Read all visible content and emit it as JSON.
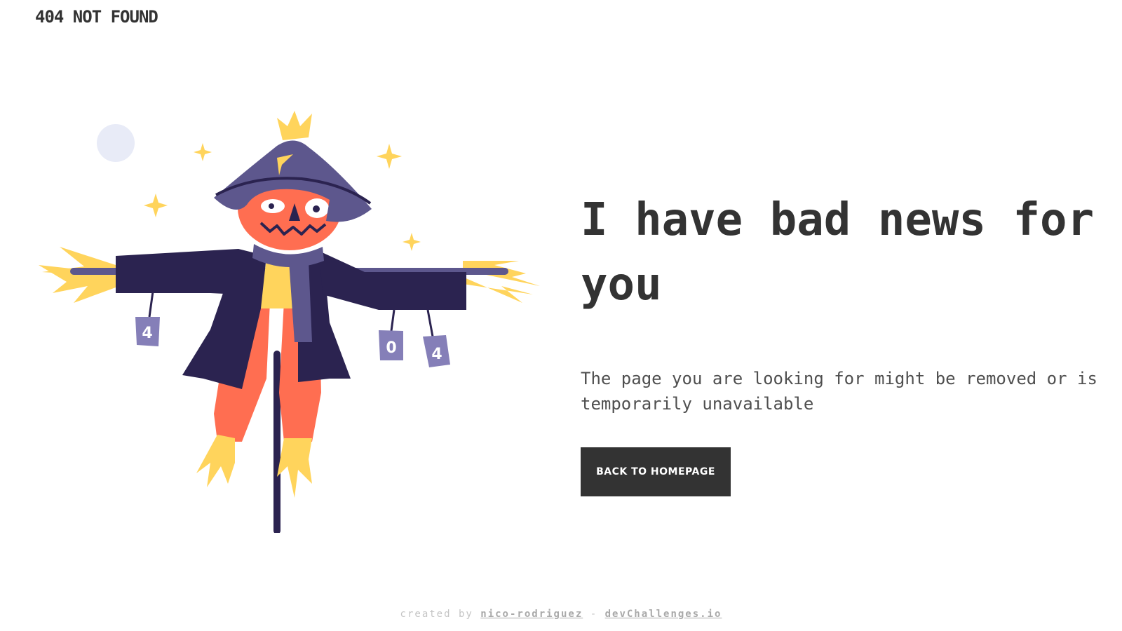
{
  "header": {
    "brand": "404 NOT FOUND"
  },
  "illustration": {
    "icon": "scarecrow-illustration",
    "can_labels": [
      "4",
      "0",
      "4"
    ]
  },
  "main": {
    "headline": "I have bad news for you",
    "message": "The page you are looking for might be removed or is temporarily unavailable",
    "button_label": "BACK TO HOMEPAGE"
  },
  "footer": {
    "prefix": "created by",
    "author": "nico-rodriguez",
    "separator": "-",
    "site": "devChallenges.io"
  },
  "colors": {
    "text": "#333333",
    "button_bg": "#333333",
    "button_text": "#ffffff",
    "scarecrow_orange": "#ff6e51",
    "scarecrow_navy": "#2b2350",
    "scarecrow_purple": "#5d578d",
    "straw_yellow": "#ffd45c",
    "moon": "#e8ebf7"
  }
}
